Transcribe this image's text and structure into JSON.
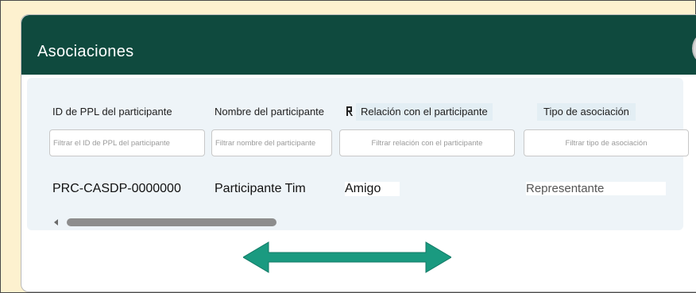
{
  "card": {
    "title": "Asociaciones"
  },
  "table": {
    "columns": [
      {
        "label": "ID de PPL del participante",
        "filter_placeholder": "Filtrar el ID de PPL del participante"
      },
      {
        "label": "Nombre del participante",
        "filter_placeholder": "Filtrar nombre del participante"
      },
      {
        "label": "Relación con el participante",
        "filter_placeholder": "Filtrar relación con el participante"
      },
      {
        "label": "Tipo de asociación",
        "filter_placeholder": "Filtrar tipo de asociación"
      }
    ],
    "rows": [
      {
        "ppl_id": "PRC-CASDP-0000000",
        "name": "Participante Tim",
        "relation": "Amigo",
        "type": "Representante"
      }
    ]
  },
  "colors": {
    "header_bg": "#0f4a3e",
    "arrow": "#1a9a80",
    "page_bg": "#fdf1cf"
  },
  "icons": [
    "sort-icon",
    "scroll-left-icon",
    "horizontal-arrow-icon"
  ]
}
